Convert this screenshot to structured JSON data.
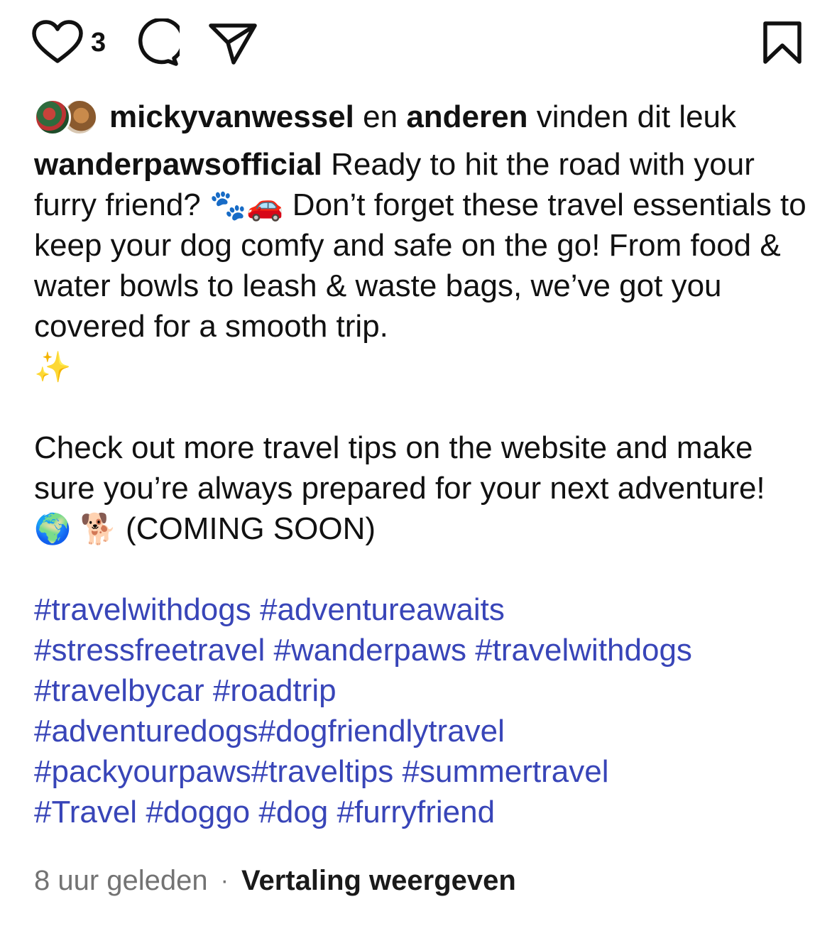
{
  "actions": {
    "like_count": "3"
  },
  "likes": {
    "user": "mickyvanwessel",
    "connector": " en ",
    "others": "anderen",
    "suffix": " vinden dit leuk"
  },
  "caption": {
    "username": "wanderpawsofficial",
    "para1_a": " Ready to hit the road with your furry friend? ",
    "emoji_paws": "🐾",
    "emoji_car": "🚗",
    "para1_b": " Don’t forget these travel essentials to keep your dog comfy and safe on the go! From food & water bowls to leash & waste bags, we’ve got you covered for a smooth trip.",
    "emoji_sparkles": "✨",
    "para2_a": "Check out more travel tips on the website and make sure you’re always prepared for your next adventure! ",
    "emoji_globe": "🌍",
    "emoji_dog": "🐕",
    "para2_b": " (COMING SOON)",
    "hashtags": [
      "#travelwithdogs",
      "#adventureawaits",
      "#stressfreetravel",
      "#wanderpaws",
      "#travelwithdogs",
      "#travelbycar",
      "#roadtrip",
      "#adventuredogs",
      "#dogfriendlytravel",
      "#packyourpaws",
      "#traveltips",
      "#summertravel",
      "#Travel",
      "#doggo",
      "#dog",
      "#furryfriend"
    ]
  },
  "meta": {
    "time": "8 uur geleden",
    "separator": "·",
    "translate": "Vertaling weergeven"
  },
  "icons": {
    "like": "heart-icon",
    "comment": "comment-icon",
    "share": "paper-plane-icon",
    "save": "bookmark-icon"
  }
}
